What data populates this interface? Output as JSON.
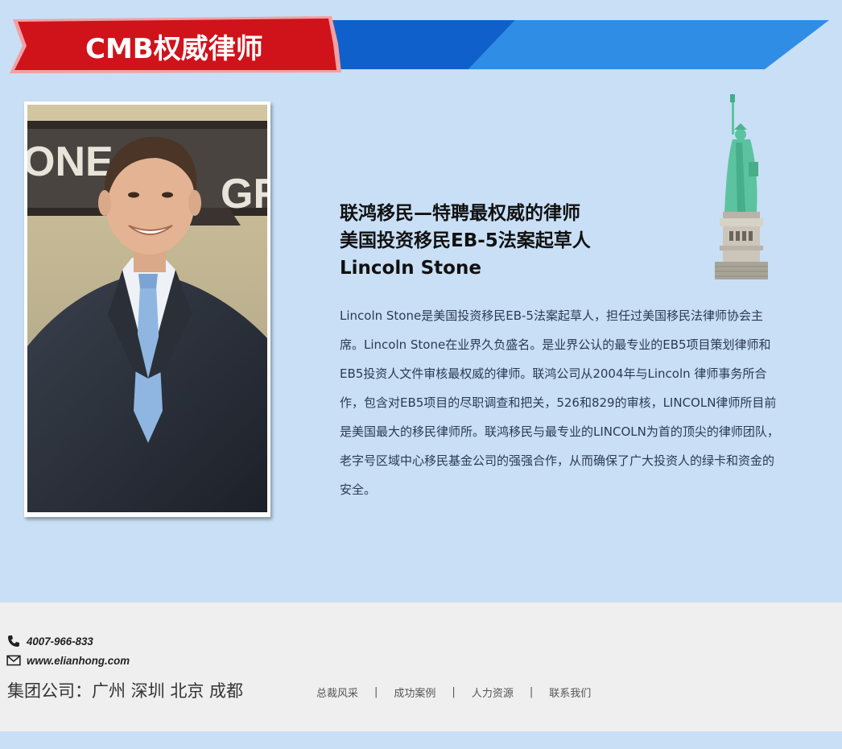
{
  "banner": {
    "title": "CMB权威律师",
    "colors": {
      "ribbon": "#d0121b",
      "ribbon_edge": "#f2a0a4",
      "stripe_dark": "#1060cc",
      "stripe_light": "#2f8de6"
    }
  },
  "profile": {
    "photo_alt": "Lincoln Stone portrait",
    "heading_lines": [
      "联鸿移民—特聘最权威的律师",
      "美国投资移民EB-5法案起草人",
      "Lincoln Stone"
    ],
    "bio": "Lincoln Stone是美国投资移民EB-5法案起草人，担任过美国移民法律师协会主席。Lincoln Stone在业界久负盛名。是业界公认的最专业的EB5项目策划律师和EB5投资人文件审核最权威的律师。联鸿公司从2004年与Lincoln 律师事务所合作，包含对EB5项目的尽职调查和把关，526和829的审核，LINCOLN律师所目前是美国最大的移民律师所。联鸿移民与最专业的LINCOLN为首的顶尖的律师团队，老字号区域中心移民基金公司的强强合作，从而确保了广大投资人的绿卡和资金的安全。"
  },
  "footer": {
    "phone": "4007-966-833",
    "phone_icon": "phone-icon",
    "website": "www.elianhong.com",
    "website_icon": "mail-icon",
    "group_company": "集团公司：广州 深圳 北京 成都",
    "nav": [
      "总裁风采",
      "成功案例",
      "人力资源",
      "联系我们"
    ],
    "nav_separator": "|"
  }
}
